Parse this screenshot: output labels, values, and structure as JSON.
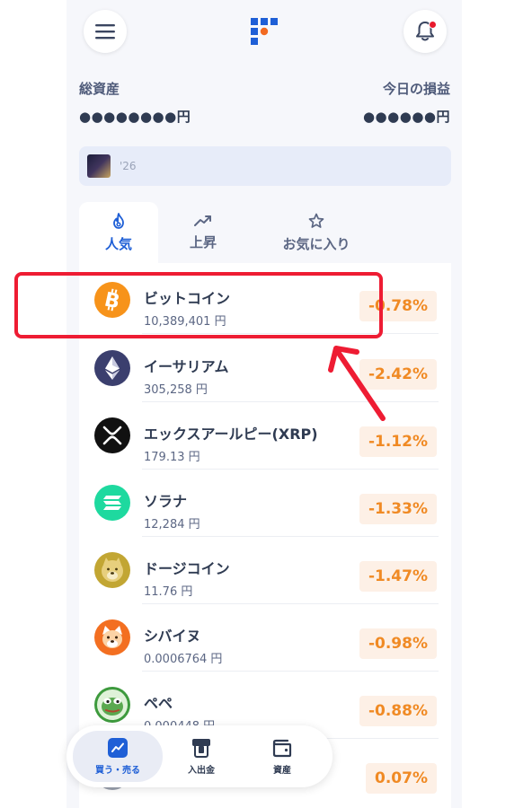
{
  "header": {
    "menu_icon": "hamburger-icon",
    "logo_icon": "brand-logo",
    "bell_icon": "bell-icon"
  },
  "summary": {
    "total_label": "総資産",
    "total_value": "●●●●●●●●円",
    "pl_label": "今日の損益",
    "pl_value": "●●●●●●円"
  },
  "banner": {
    "text": "'26"
  },
  "tabs": [
    {
      "label": "人気",
      "icon": "flame-icon",
      "active": true
    },
    {
      "label": "上昇",
      "icon": "trending-up-icon",
      "active": false
    },
    {
      "label": "お気に入り",
      "icon": "star-icon",
      "active": false
    }
  ],
  "coins": [
    {
      "name": "ビットコイン",
      "price": "10,389,401 円",
      "change": "-0.78%",
      "icon": "bitcoin-icon",
      "color": "#f7931a"
    },
    {
      "name": "イーサリアム",
      "price": "305,258 円",
      "change": "-2.42%",
      "icon": "ethereum-icon",
      "color": "#3b3f6e"
    },
    {
      "name": "エックスアールピー(XRP)",
      "price": "179.13 円",
      "change": "-1.12%",
      "icon": "xrp-icon",
      "color": "#111111"
    },
    {
      "name": "ソラナ",
      "price": "12,284 円",
      "change": "-1.33%",
      "icon": "solana-icon",
      "color": "#1ed99f"
    },
    {
      "name": "ドージコイン",
      "price": "11.76 円",
      "change": "-1.47%",
      "icon": "dogecoin-icon",
      "color": "#c2a633"
    },
    {
      "name": "シバイヌ",
      "price": "0.0006764 円",
      "change": "-0.98%",
      "icon": "shiba-inu-icon",
      "color": "#f36f21"
    },
    {
      "name": "ペペ",
      "price": "0.000448 円",
      "change": "-0.88%",
      "icon": "pepe-icon",
      "color": "#3d9a3d"
    },
    {
      "name": "",
      "price": "",
      "change": "0.07%",
      "icon": "stellar-icon",
      "color": "#9aa0ad"
    }
  ],
  "nav": [
    {
      "label": "買う・売る",
      "icon": "chart-trend-icon",
      "active": true
    },
    {
      "label": "入出金",
      "icon": "atm-icon",
      "active": false
    },
    {
      "label": "資産",
      "icon": "wallet-icon",
      "active": false
    }
  ],
  "colors": {
    "accent": "#1f5fd6",
    "change_text": "#f08a24",
    "change_bg": "#fdf0e6",
    "highlight": "#ee1c33"
  }
}
